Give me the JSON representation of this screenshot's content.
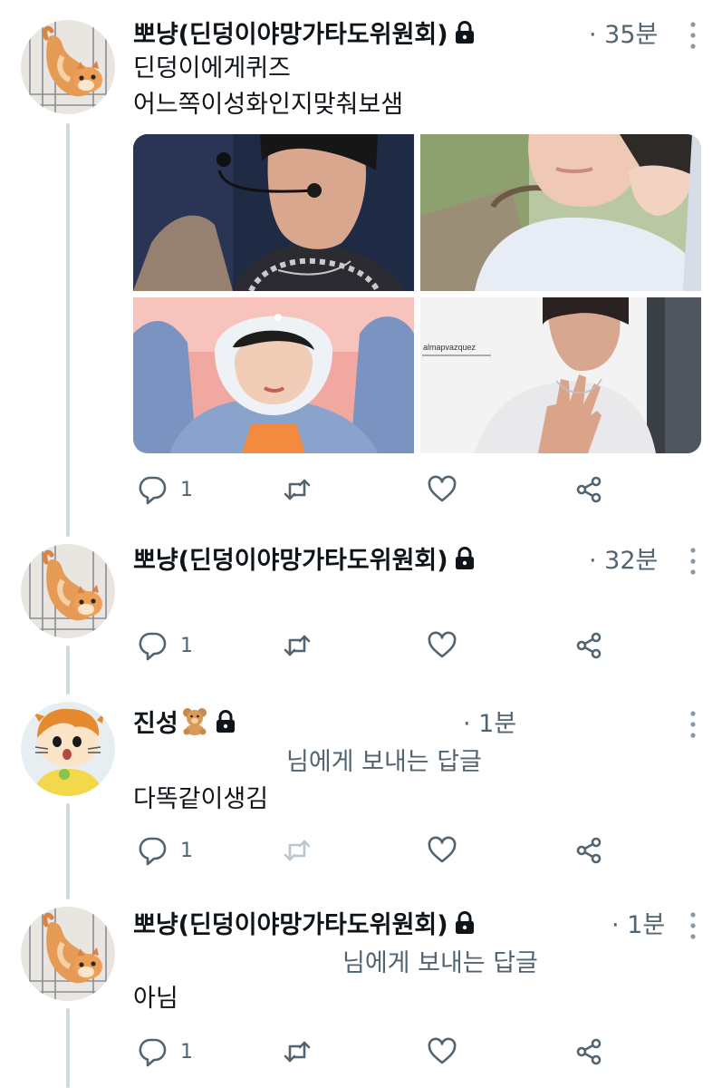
{
  "lock_icon": "lock-icon",
  "colors": {
    "text": "#0f1419",
    "secondary": "#536471",
    "thread_line": "#cfd9de",
    "retweet_disabled": "#b9c6cd"
  },
  "tweets": [
    {
      "author": "뽀냥(딘덩이야망가타도위원회)",
      "time": "· 35분",
      "lines": [
        "딘덩이에게퀴즈",
        "어느쪽이성화인지맞춰보샘"
      ],
      "media_watermark": "almapvazquez",
      "replies": "1"
    },
    {
      "author": "뽀냥(딘덩이야망가타도위원회)",
      "time": "· 32분",
      "replies": "1"
    },
    {
      "author": "진성",
      "author_emoji": "teddy-bear-icon",
      "time": "· 1분",
      "reply_to": "님에게 보내는 답글",
      "lines": [
        "다똑같이생김"
      ],
      "replies": "1"
    },
    {
      "author": "뽀냥(딘덩이야망가타도위원회)",
      "time": "· 1분",
      "reply_to": "님에게 보내는 답글",
      "lines": [
        "아님"
      ],
      "replies": "1"
    }
  ]
}
